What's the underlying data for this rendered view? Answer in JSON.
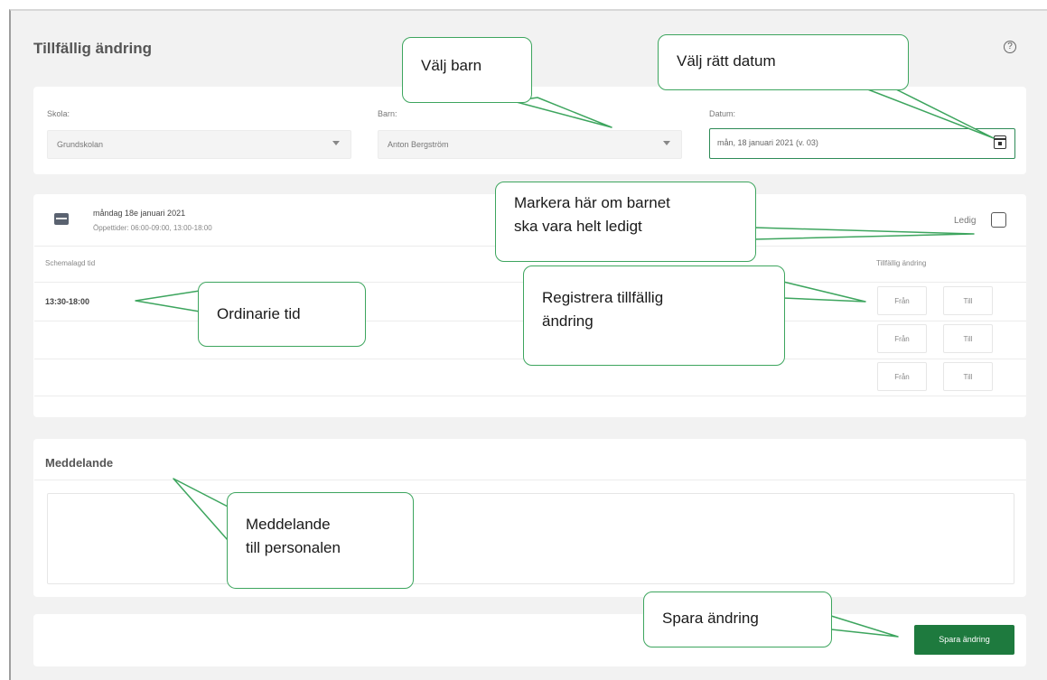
{
  "header": {
    "title": "Tillfällig ändring",
    "help_icon": "question-circle-icon"
  },
  "filters": {
    "school": {
      "label": "Skola:",
      "value": "Grundskolan"
    },
    "child": {
      "label": "Barn:",
      "value": "Anton Bergström"
    },
    "date": {
      "label": "Datum:",
      "value": "mån, 18 januari 2021 (v. 03)",
      "icon": "calendar-icon"
    }
  },
  "schedule": {
    "day_title": "måndag 18e januari 2021",
    "opening_hours": "Öppettider: 06:00-09:00, 13:00-18:00",
    "free_label": "Ledig",
    "col_scheduled": "Schemalagd tid",
    "col_temporary": "Tillfällig ändring",
    "scheduled_time": "13:30-18:00",
    "rows": [
      {
        "from": "Från",
        "to": "Till"
      },
      {
        "from": "Från",
        "to": "Till"
      },
      {
        "from": "Från",
        "to": "Till"
      }
    ]
  },
  "message": {
    "title": "Meddelande"
  },
  "actions": {
    "save_label": "Spara ändring"
  },
  "annotations": {
    "choose_child": "Välj barn",
    "choose_date": "Välj rätt datum",
    "mark_free_1": "Markera här om barnet",
    "mark_free_2": "ska vara helt ledigt",
    "register_1": "Registrera tillfällig",
    "register_2": "ändring",
    "ordinary": "Ordinarie tid",
    "message_1": "Meddelande",
    "message_2": "till personalen",
    "save": "Spara ändring"
  },
  "colors": {
    "accent": "#1e7a3e",
    "callout_border": "#3da55e",
    "background": "#f2f2f2"
  }
}
